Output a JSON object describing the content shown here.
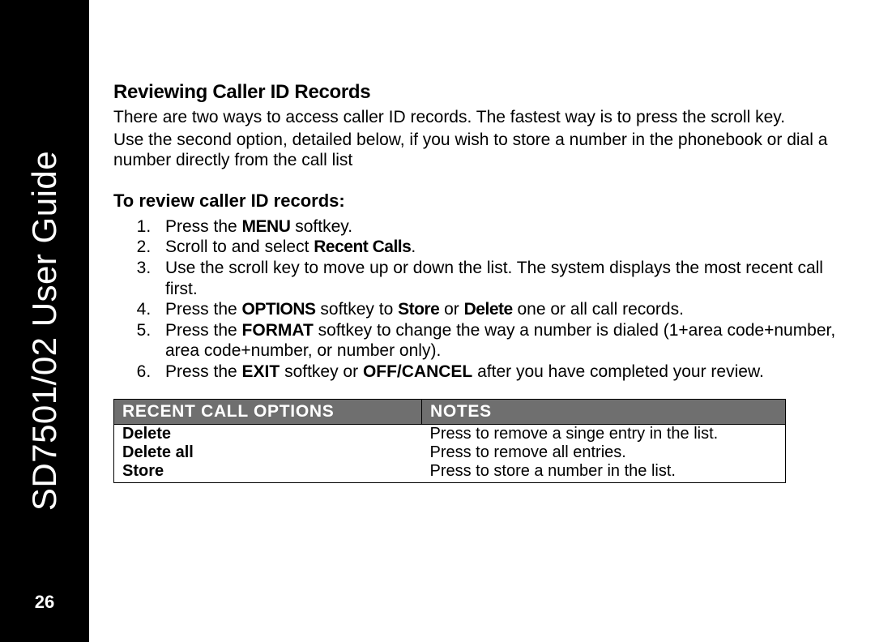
{
  "sidebar": {
    "title": "SD7501/02 User Guide",
    "page_number": "26"
  },
  "section": {
    "heading": "Reviewing Caller ID Records",
    "para1": "There are two ways to access caller ID records. The fastest way is to press the scroll key.",
    "para2": "Use the second option, detailed below, if you wish to store a number in the phonebook or dial a number directly from the call list"
  },
  "steps": {
    "heading": "To review caller ID records:",
    "s1a": "Press the ",
    "s1b": "MENU",
    "s1c": " softkey.",
    "s2a": "Scroll to and select ",
    "s2b": "Recent Calls",
    "s2c": ".",
    "s3": "Use the scroll key to move up or down the list. The system displays the most recent call first.",
    "s4a": "Press the ",
    "s4b": "OPTIONS",
    "s4c": " softkey to ",
    "s4d": "Store",
    "s4e": " or ",
    "s4f": "Delete",
    "s4g": " one or all call records.",
    "s5a": "Press the ",
    "s5b": "FORMAT",
    "s5c": " softkey to change the way a number is dialed (1+area code+number, area code+number, or number only).",
    "s6a": "Press the ",
    "s6b": "EXIT",
    "s6c": " softkey or ",
    "s6d": "OFF/CANCEL",
    "s6e": " after you have completed your review."
  },
  "table": {
    "h1": "RECENT CALL OPTIONS",
    "h2": "NOTES",
    "r1c1": "Delete",
    "r1c2": "Press to remove a singe entry in the list.",
    "r2c1": "Delete all",
    "r2c2": "Press to remove all entries.",
    "r3c1": "Store",
    "r3c2": "Press to store a number in the list."
  }
}
